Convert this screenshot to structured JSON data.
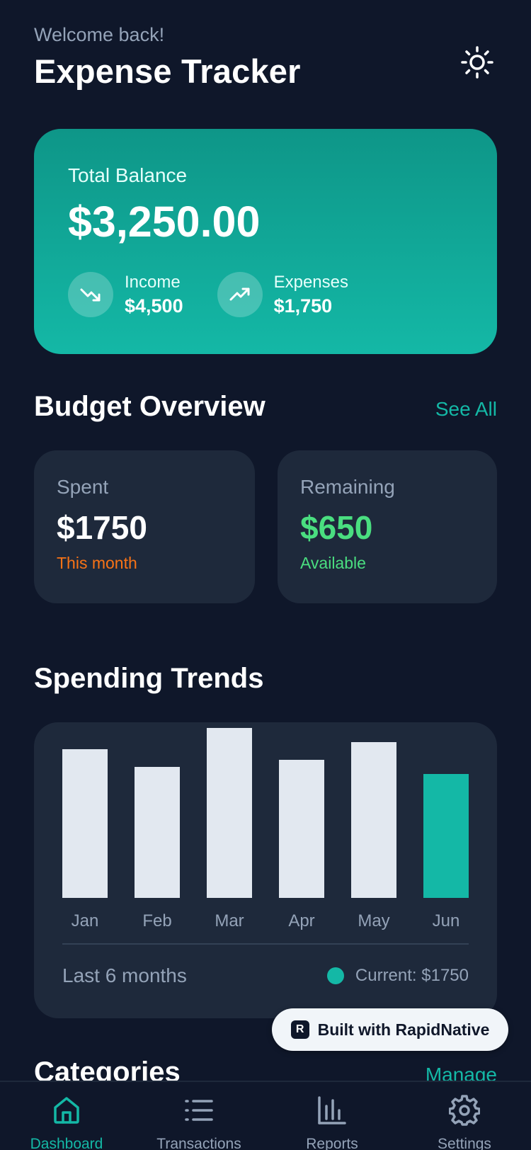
{
  "header": {
    "welcome": "Welcome back!",
    "title": "Expense Tracker"
  },
  "balance": {
    "label": "Total Balance",
    "value": "$3,250.00",
    "income_label": "Income",
    "income_value": "$4,500",
    "expenses_label": "Expenses",
    "expenses_value": "$1,750"
  },
  "budget": {
    "title": "Budget Overview",
    "see_all": "See All",
    "spent_label": "Spent",
    "spent_value": "$1750",
    "spent_sub": "This month",
    "remaining_label": "Remaining",
    "remaining_value": "$650",
    "remaining_sub": "Available"
  },
  "trends": {
    "title": "Spending Trends",
    "footer_label": "Last 6 months",
    "legend": "Current: $1750"
  },
  "chart_data": {
    "type": "bar",
    "categories": [
      "Jan",
      "Feb",
      "Mar",
      "Apr",
      "May",
      "Jun"
    ],
    "values": [
      2100,
      1850,
      2400,
      1950,
      2200,
      1750
    ],
    "ylim": [
      0,
      2400
    ],
    "highlight_index": 5,
    "colors": {
      "default": "#e2e8f0",
      "highlight": "#14b8a6"
    }
  },
  "badge": {
    "text": "Built with RapidNative"
  },
  "categories": {
    "title": "Categories",
    "manage": "Manage"
  },
  "tabs": [
    {
      "label": "Dashboard",
      "icon": "home-icon",
      "active": true
    },
    {
      "label": "Transactions",
      "icon": "list-icon",
      "active": false
    },
    {
      "label": "Reports",
      "icon": "bar-chart-icon",
      "active": false
    },
    {
      "label": "Settings",
      "icon": "gear-icon",
      "active": false
    }
  ],
  "colors": {
    "background": "#0f172a",
    "card": "#1e293b",
    "accent": "#14b8a6",
    "spent": "#f97316",
    "remaining": "#4ade80"
  }
}
